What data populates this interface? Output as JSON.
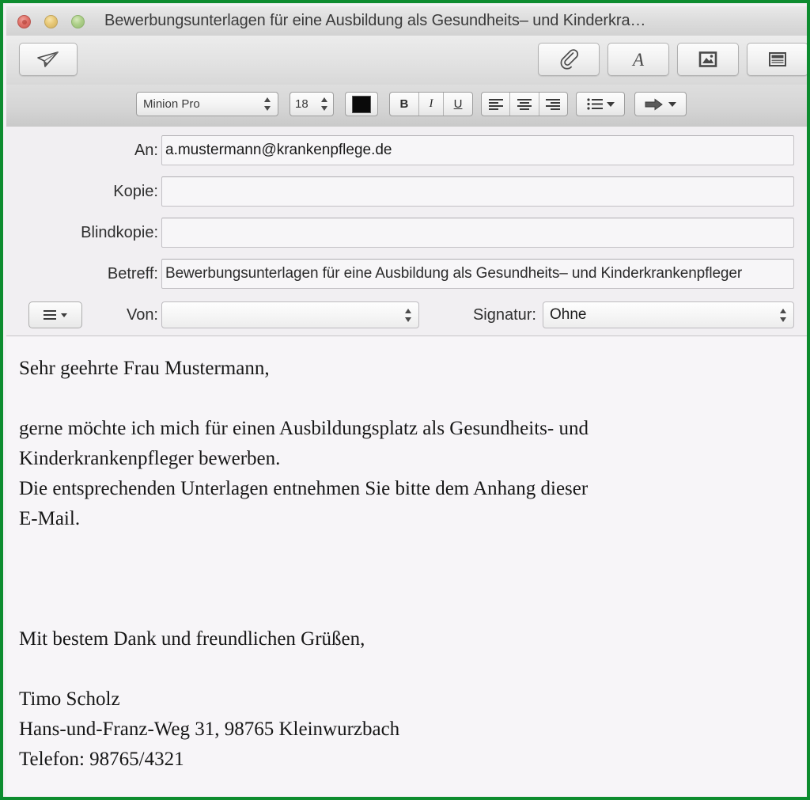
{
  "window": {
    "title": "Bewerbungsunterlagen für eine Ausbildung als Gesundheits– und Kinderkra…",
    "traffic_lights": {
      "close": "close-button",
      "minimize": "minimize-button",
      "zoom": "zoom-button"
    }
  },
  "toolbar": {
    "send_label": "send-icon",
    "attach_label": "attach-icon",
    "fonts_label": "A",
    "photos_label": "photo-browser-icon",
    "stationery_label": "stationery-icon"
  },
  "formatbar": {
    "font_family": "Minion Pro",
    "font_size": "18",
    "text_color": "#0a0a0a",
    "bold_label": "B",
    "italic_label": "I",
    "underline_label": "U",
    "align_left_label": "align-left",
    "align_center_label": "align-center",
    "align_right_label": "align-right",
    "list_label": "lists-menu",
    "indent_label": "indent-menu"
  },
  "headers": {
    "an_label": "An:",
    "an_value": "a.mustermann@krankenpflege.de",
    "kopie_label": "Kopie:",
    "kopie_value": "",
    "blindkopie_label": "Blindkopie:",
    "blindkopie_value": "",
    "betreff_label": "Betreff:",
    "betreff_value": "Bewerbungsunterlagen für eine Ausbildung als Gesundheits– und Kinderkrankenpfleger",
    "von_label": "Von:",
    "von_value": "",
    "signatur_label": "Signatur:",
    "signatur_value": "Ohne",
    "header_menu_label": "header-fields-menu"
  },
  "body": {
    "line1": "Sehr geehrte Frau Mustermann,",
    "line2": "gerne möchte ich mich für einen Ausbildungsplatz als Gesundheits- und",
    "line3": "Kinderkrankenpfleger bewerben.",
    "line4": "Die entsprechenden Unterlagen entnehmen Sie bitte dem Anhang dieser",
    "line5": "E-Mail.",
    "line6": "Mit bestem Dank und freundlichen Grüßen,",
    "line7": "Timo Scholz",
    "line8": "Hans-und-Franz-Weg 31, 98765 Kleinwurzbach",
    "line9": "Telefon: 98765/4321"
  },
  "colors": {
    "frame_green": "#0d8c2f",
    "header_background": "#f1eff2",
    "body_background": "#f7f5f8"
  }
}
